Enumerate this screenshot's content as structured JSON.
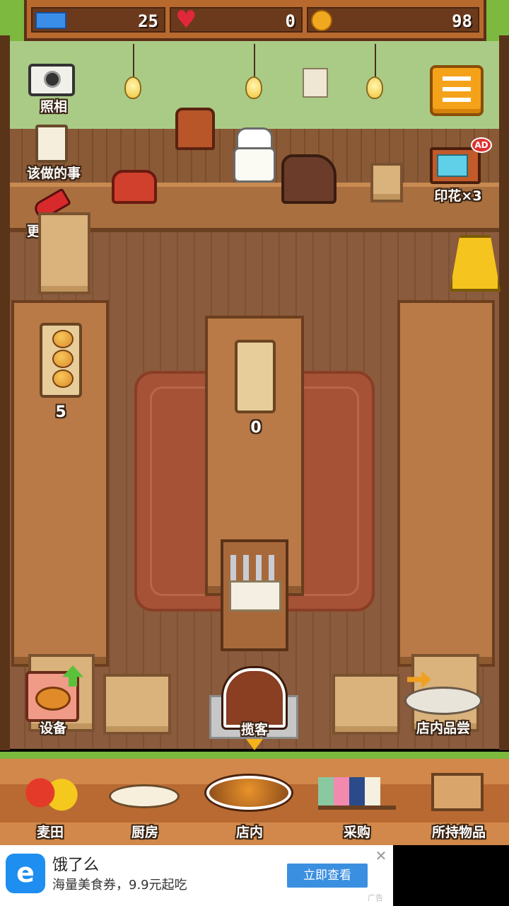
{
  "status": {
    "tickets": "25",
    "hearts": "0",
    "coins": "98"
  },
  "left_menu": {
    "photo": "照相",
    "todo": "该做的事",
    "decorate": "更换装饰"
  },
  "right_menu": {
    "stamp": "印花×3",
    "ad_badge": "AD"
  },
  "shelves": {
    "left_count": "5",
    "center_count": "0"
  },
  "actions": {
    "equipment": "设备",
    "attract": "揽客",
    "tasting": "店内品尝"
  },
  "nav": {
    "items": [
      {
        "label": "麦田"
      },
      {
        "label": "厨房"
      },
      {
        "label": "店内"
      },
      {
        "label": "采购"
      },
      {
        "label": "所持物品"
      }
    ]
  },
  "ad": {
    "title": "饿了么",
    "subtitle": "海量美食券，9.9元起吃",
    "button": "立即查看",
    "tag": "广告"
  },
  "colors": {
    "grass": "#7db83f",
    "wall": "#aacb86",
    "floor": "#8a5b3c",
    "menu_button": "#f5a21b",
    "ad_button": "#3b8fe0"
  }
}
